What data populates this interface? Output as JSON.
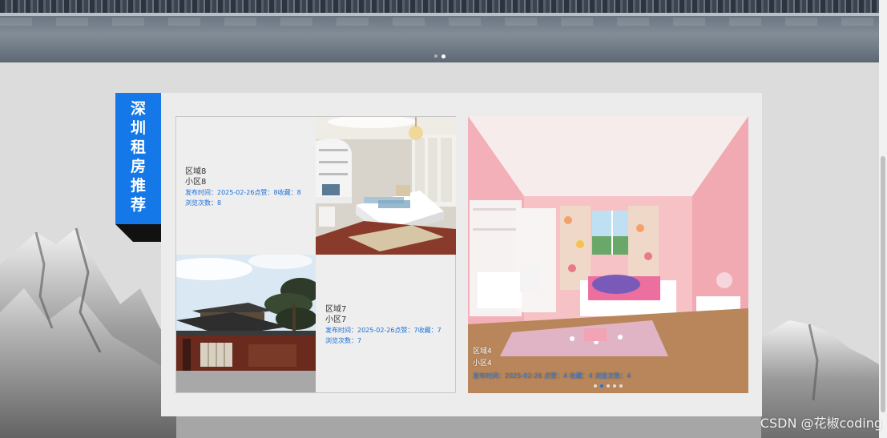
{
  "banner": {
    "slide_count": 2,
    "active_slide": 2
  },
  "section": {
    "title": "深圳租房推荐"
  },
  "listings": [
    {
      "region": "区域8",
      "community": "小区8",
      "meta_line1": "发布时间：2025-02-26点赞：8收藏：8",
      "meta_line2": "浏览次数：8"
    },
    {
      "region": "区域7",
      "community": "小区7",
      "meta_line1": "发布时间：2025-02-26点赞：7收藏：7",
      "meta_line2": "浏览次数：7"
    }
  ],
  "featured": {
    "region": "区域4",
    "community": "小区4",
    "meta": "发布时间：2025-02-26 点赞：4 收藏：4 浏览次数：4",
    "slide_count": 5,
    "active_slide": 2
  },
  "watermark": "CSDN @花椒coding",
  "colors": {
    "accent": "#1478e8",
    "meta_text": "#1a6fd8",
    "panel_bg": "#ececec"
  }
}
